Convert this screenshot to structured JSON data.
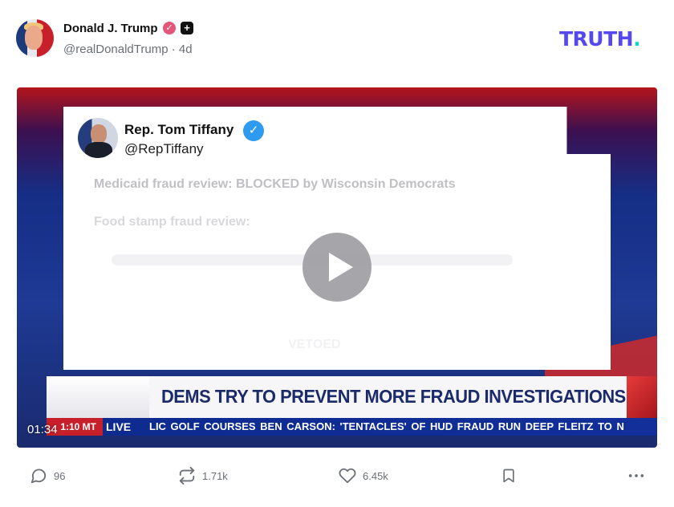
{
  "author": {
    "display_name": "Donald J. Trump",
    "handle": "@realDonaldTrump",
    "age": "4d",
    "verified_icon": "verified-check-badge",
    "plus_icon": "plus-square-badge"
  },
  "brand": {
    "logo_text": "TRUTH",
    "logo_dot": ".",
    "accent_color": "#5448EE",
    "dot_color": "#17D4C7"
  },
  "video": {
    "timestamp": "01:34",
    "tweet": {
      "name": "Rep. Tom Tiffany",
      "handle": "@RepTiffany",
      "line1": "Medicaid fraud review: BLOCKED by Wisconsin Democrats",
      "line2": "Food stamp fraud review:",
      "line3": "VETOED"
    },
    "chyron": {
      "headline": "DEMS TRY TO PREVENT MORE FRAUD INVESTIGATIONS",
      "ticker_time": "1:10 MT",
      "ticker_live": "LIVE",
      "ticker_text": "LIC GOLF COURSES     BEN CARSON: 'TENTACLES' OF HUD FRAUD RUN DEEP     FLEITZ TO N"
    },
    "play_icon": "play-icon"
  },
  "actions": {
    "replies": "96",
    "retruths": "1.71k",
    "likes": "6.45k"
  }
}
